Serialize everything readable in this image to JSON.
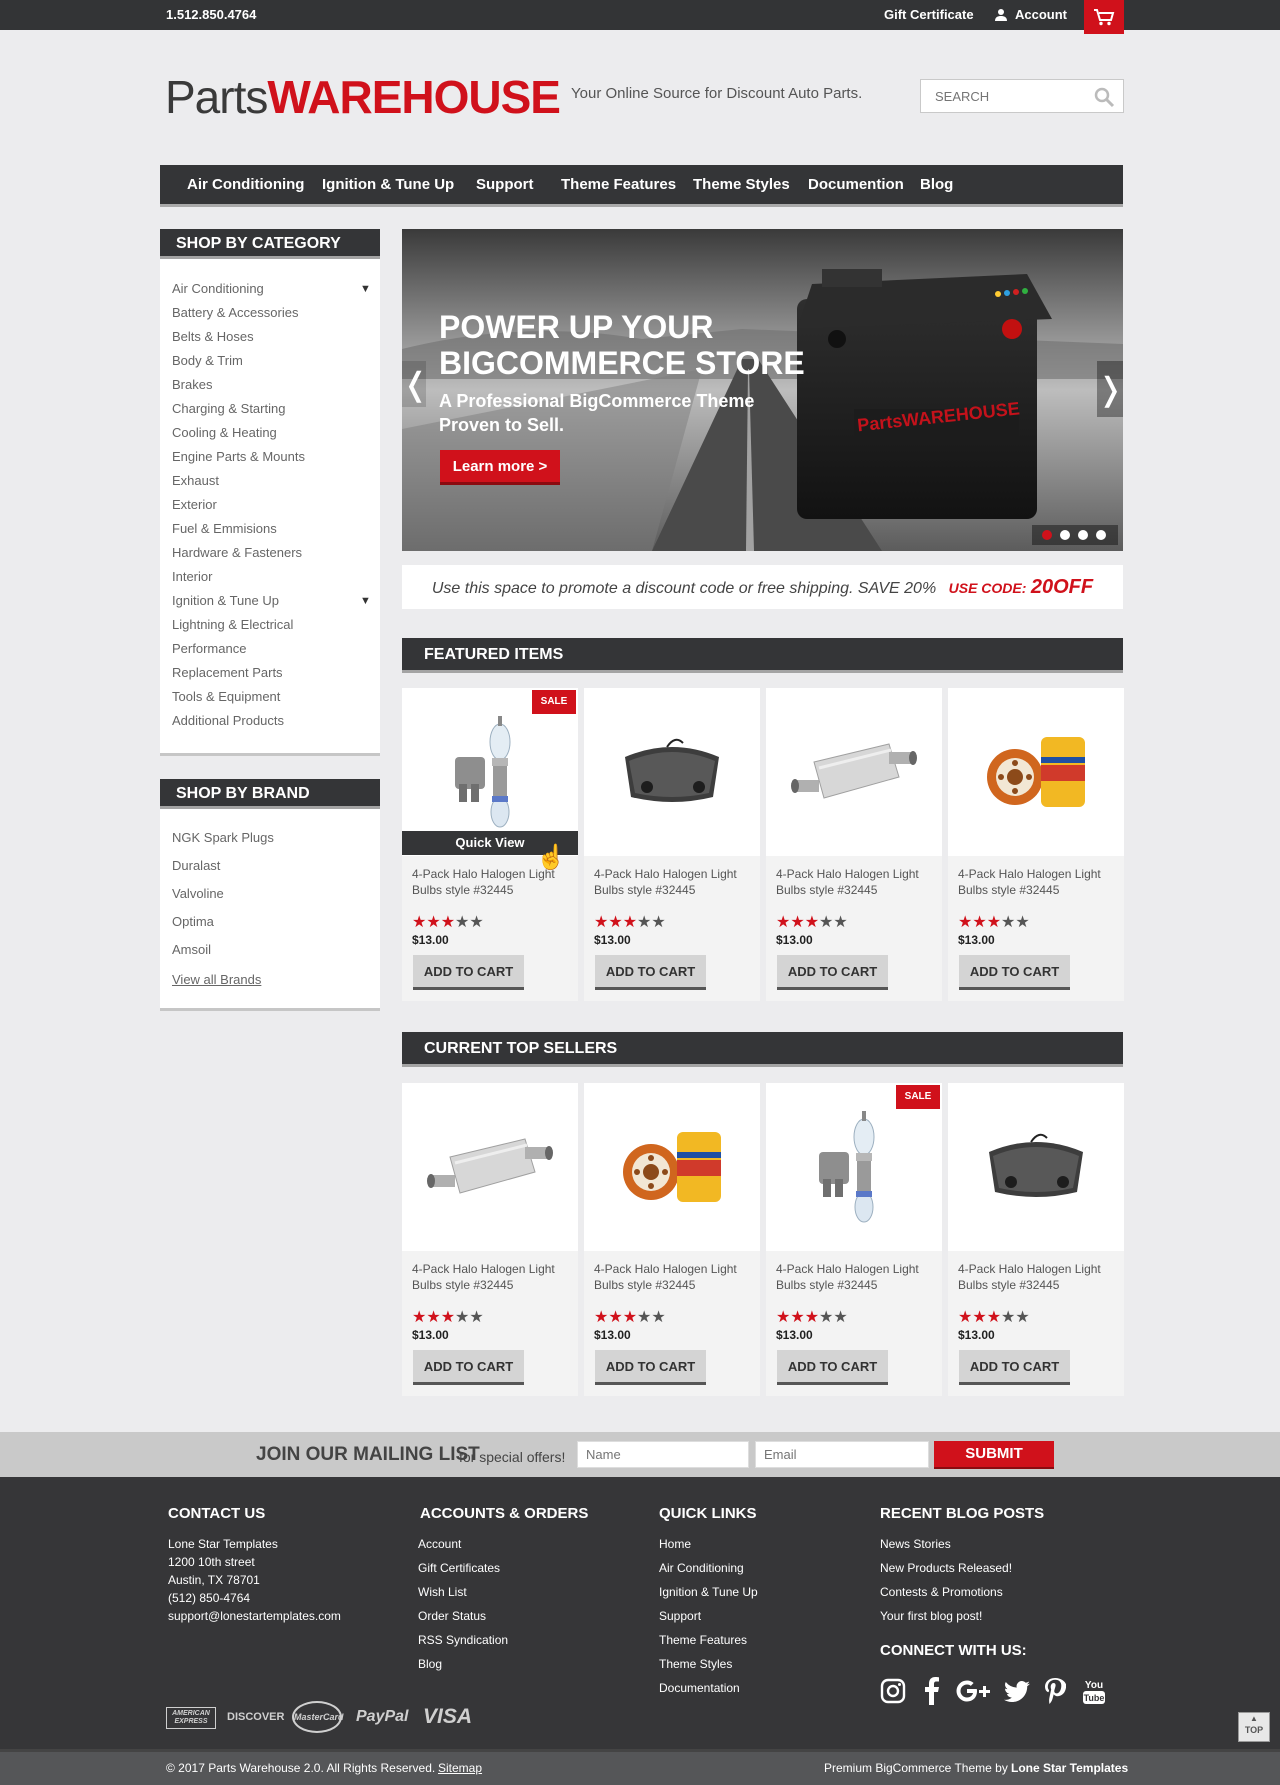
{
  "topbar": {
    "phone": "1.512.850.4764",
    "gift": "Gift Certificate",
    "account": "Account"
  },
  "header": {
    "logo_parts": "Parts",
    "logo_warehouse": "WAREHOUSE",
    "tagline": "Your Online Source for Discount Auto Parts.",
    "search_placeholder": "SEARCH"
  },
  "nav": [
    "Air Conditioning",
    "Ignition & Tune Up",
    "Support",
    "Theme Features",
    "Theme Styles",
    "Documention",
    "Blog"
  ],
  "sidebar": {
    "category_title": "SHOP BY CATEGORY",
    "categories": [
      "Air Conditioning",
      "Battery & Accessories",
      "Belts & Hoses",
      "Body & Trim",
      "Brakes",
      "Charging & Starting",
      "Cooling & Heating",
      "Engine Parts & Mounts",
      "Exhaust",
      "Exterior",
      "Fuel & Emmisions",
      "Hardware & Fasteners",
      "Interior",
      "Ignition & Tune Up",
      "Lightning & Electrical",
      "Performance",
      "Replacement Parts",
      "Tools & Equipment",
      "Additional Products"
    ],
    "brand_title": "SHOP BY BRAND",
    "brands": [
      "NGK Spark Plugs",
      "Duralast",
      "Valvoline",
      "Optima",
      "Amsoil"
    ],
    "view_all": "View all Brands"
  },
  "slider": {
    "title_line1": "POWER UP YOUR",
    "title_line2": "BIGCOMMERCE STORE",
    "sub_line1": "A Professional BigCommerce Theme",
    "sub_line2": "Proven to Sell.",
    "button": "Learn more >",
    "battery_label": "PartsWAREHOUSE",
    "prev": "❬",
    "next": "❭",
    "active_dot": 1,
    "dots": 4
  },
  "promo": {
    "text": "Use this space to promote a discount code or free shipping. SAVE 20%",
    "code_label": "USE CODE:",
    "code": "20OFF"
  },
  "featured": {
    "title": "FEATURED ITEMS",
    "quick_view": "Quick View",
    "products": [
      {
        "image": "bulb",
        "name": "4-Pack Halo Halogen Light Bulbs style #32445",
        "rating": 3,
        "price": "$13.00",
        "sale": true
      },
      {
        "image": "brakepad",
        "name": "4-Pack Halo Halogen Light Bulbs style #32445",
        "rating": 3,
        "price": "$13.00",
        "sale": false
      },
      {
        "image": "muffler",
        "name": "4-Pack Halo Halogen Light Bulbs style #32445",
        "rating": 3,
        "price": "$13.00",
        "sale": false
      },
      {
        "image": "oilfilter",
        "name": "4-Pack Halo Halogen Light Bulbs style #32445",
        "rating": 3,
        "price": "$13.00",
        "sale": false
      }
    ]
  },
  "topsellers": {
    "title": "CURRENT TOP SELLERS",
    "products": [
      {
        "image": "muffler",
        "name": "4-Pack Halo Halogen Light Bulbs style #32445",
        "rating": 3,
        "price": "$13.00",
        "sale": false
      },
      {
        "image": "oilfilter",
        "name": "4-Pack Halo Halogen Light Bulbs style #32445",
        "rating": 3,
        "price": "$13.00",
        "sale": false
      },
      {
        "image": "bulb",
        "name": "4-Pack Halo Halogen Light Bulbs style #32445",
        "rating": 3,
        "price": "$13.00",
        "sale": true
      },
      {
        "image": "brakepad",
        "name": "4-Pack Halo Halogen Light Bulbs style #32445",
        "rating": 3,
        "price": "$13.00",
        "sale": false
      }
    ]
  },
  "labels": {
    "add_to_cart": "ADD TO CART",
    "sale": "SALE"
  },
  "mailing": {
    "title": "JOIN OUR MAILING LIST",
    "subtitle": "for special offers!",
    "name_placeholder": "Name",
    "email_placeholder": "Email",
    "submit": "SUBMIT"
  },
  "footer": {
    "contact": {
      "title": "CONTACT US",
      "lines": [
        "Lone Star Templates",
        "1200 10th street",
        "Austin, TX 78701",
        "(512) 850-4764",
        "support@lonestartemplates.com"
      ]
    },
    "accounts": {
      "title": "ACCOUNTS & ORDERS",
      "links": [
        "Account",
        "Gift Certificates",
        "Wish List",
        "Order Status",
        "RSS Syndication",
        "Blog"
      ]
    },
    "quick": {
      "title": "QUICK LINKS",
      "links": [
        "Home",
        "Air Conditioning",
        "Ignition & Tune Up",
        "Support",
        "Theme Features",
        "Theme Styles",
        "Documentation"
      ]
    },
    "blog": {
      "title": "RECENT BLOG POSTS",
      "links": [
        "News Stories",
        "New Products Released!",
        "Contests & Promotions",
        "Your first blog post!"
      ]
    },
    "connect_title": "CONNECT WITH US:",
    "payments": [
      "AMERICAN EXPRESS",
      "DISCOVER",
      "MasterCard",
      "PayPal",
      "VISA"
    ],
    "top": "TOP"
  },
  "bottom": {
    "copyright": "© 2017 Parts Warehouse 2.0. All Rights Reserved.",
    "sitemap": "Sitemap",
    "credit_prefix": "Premium BigCommerce Theme by",
    "credit_name": "Lone Star Templates"
  },
  "colors": {
    "accent": "#d0111b",
    "dark": "#343537",
    "background": "#ececee"
  }
}
